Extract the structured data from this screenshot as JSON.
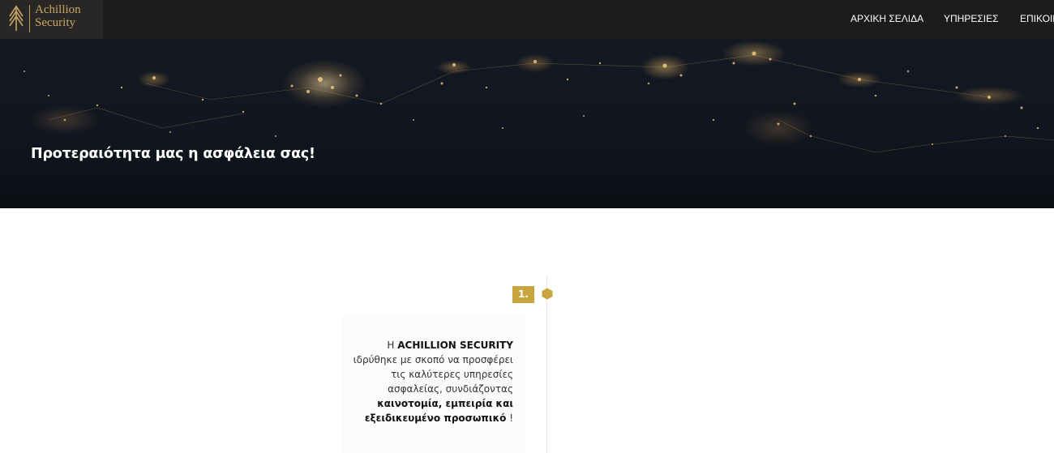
{
  "brand": {
    "name_line1": "Achillion",
    "name_line2": "Security",
    "accent_color": "#c9a53f",
    "logo_icon": "arrow-chevrons-icon"
  },
  "nav": {
    "items": [
      {
        "label": "ΑΡΧΙΚΗ ΣΕΛΙΔΑ"
      },
      {
        "label": "ΥΠΗΡΕΣΙΕΣ"
      },
      {
        "label": "ΕΠΙΚΟΙΝ"
      }
    ]
  },
  "hero": {
    "title": "Προτεραιότητα μας η ασφάλεια σας!"
  },
  "timeline": {
    "step_label": "1.",
    "marker_icon": "hexagon-icon",
    "card": {
      "intro": "Η ",
      "company": "ACHILLION SECURITY",
      "body": " ιδρύθηκε με σκοπό να προσφέρει τις καλύτερες υπηρεσίες ασφαλείας, συνδιάζοντας ",
      "emphasis": "καινοτομία, εμπειρία και εξειδικευμένο προσωπικό",
      "ending": " !"
    }
  }
}
